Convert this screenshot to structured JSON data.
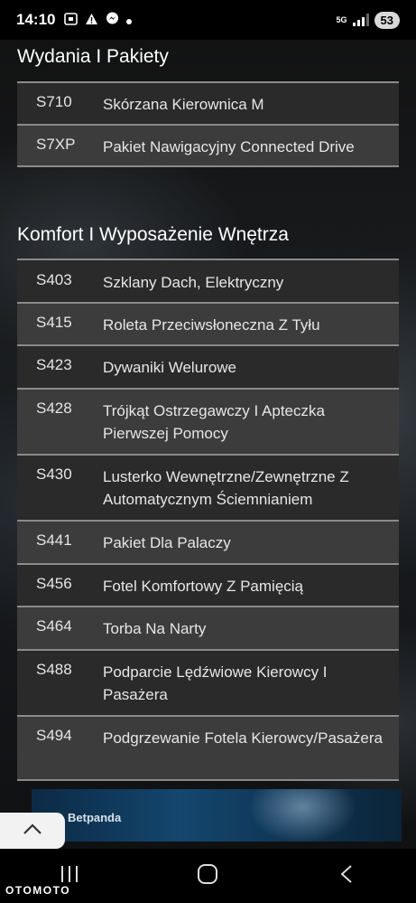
{
  "status_bar": {
    "time": "14:10",
    "network": "5G",
    "battery": "53",
    "icons": [
      "screenshot-icon",
      "alert-icon",
      "messenger-icon",
      "dot-icon",
      "signal-icon"
    ]
  },
  "sections": [
    {
      "title": "Wydania I Pakiety",
      "rows": [
        {
          "code": "S710",
          "desc": "Skórzana Kierownica M"
        },
        {
          "code": "S7XP",
          "desc": "Pakiet Nawigacyjny Connected Drive"
        }
      ]
    },
    {
      "title": "Komfort I Wyposażenie Wnętrza",
      "rows": [
        {
          "code": "S403",
          "desc": "Szklany Dach, Elektryczny"
        },
        {
          "code": "S415",
          "desc": "Roleta Przeciwsłoneczna Z Tyłu"
        },
        {
          "code": "S423",
          "desc": "Dywaniki Welurowe"
        },
        {
          "code": "S428",
          "desc": "Trójkąt Ostrzegawczy I Apteczka Pierwszej Pomocy"
        },
        {
          "code": "S430",
          "desc": "Lusterko Wewnętrzne/Zewnętrzne Z Automatycznym Ściemnianiem"
        },
        {
          "code": "S441",
          "desc": "Pakiet Dla Palaczy"
        },
        {
          "code": "S456",
          "desc": "Fotel Komfortowy Z Pamięcią"
        },
        {
          "code": "S464",
          "desc": "Torba Na Narty"
        },
        {
          "code": "S488",
          "desc": "Podparcie Lędźwiowe Kierowcy I Pasażera"
        },
        {
          "code": "S494",
          "desc": "Podgrzewanie Fotela Kierowcy/Pasażera"
        }
      ]
    }
  ],
  "ad": {
    "brand": "Betpanda"
  },
  "watermark": "OTOMOTO",
  "nav": {
    "icons": [
      "recent-apps-icon",
      "home-icon",
      "back-icon"
    ]
  },
  "scroll_up": {
    "icon": "chevron-up-icon"
  }
}
